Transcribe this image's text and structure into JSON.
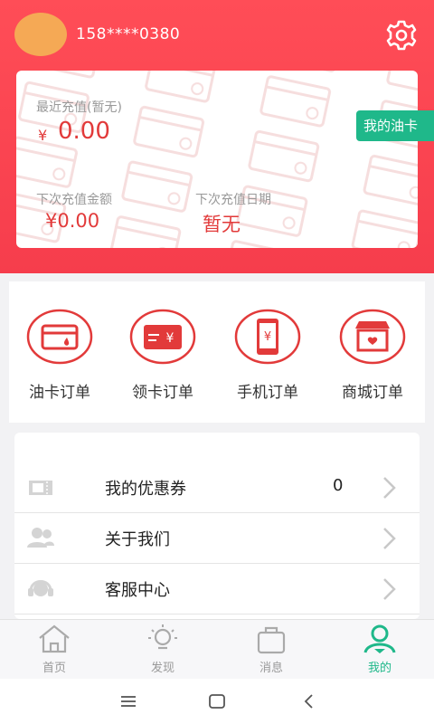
{
  "header": {
    "phone": "158****0380",
    "settings_icon": "gear-icon"
  },
  "card": {
    "recent_label": "最近充值(暂无)",
    "recent_currency": "¥",
    "recent_amount": "0.00",
    "next_amount_label": "下次充值金额",
    "next_amount": "¥0.00",
    "next_date_label": "下次充值日期",
    "next_date": "暂无",
    "oil_card_label": "我的油卡",
    "oil_card_arrow": "〉"
  },
  "orders": [
    {
      "label": "油卡订单",
      "icon": "oil-card-icon"
    },
    {
      "label": "领卡订单",
      "icon": "card-yuan-icon"
    },
    {
      "label": "手机订单",
      "icon": "phone-yuan-icon"
    },
    {
      "label": "商城订单",
      "icon": "shop-icon"
    }
  ],
  "menu": [
    {
      "label": "我的优惠券",
      "count": "0",
      "icon": "coupon-icon"
    },
    {
      "label": "关于我们",
      "icon": "users-icon"
    },
    {
      "label": "客服中心",
      "icon": "headset-icon"
    }
  ],
  "tabs": [
    {
      "label": "首页",
      "icon": "home-icon"
    },
    {
      "label": "发现",
      "icon": "bulb-icon"
    },
    {
      "label": "消息",
      "icon": "bag-icon"
    },
    {
      "label": "我的",
      "icon": "user-icon"
    }
  ],
  "colors": {
    "brand_red": "#f63d4c",
    "value_red": "#e23a3a",
    "accent_green": "#1fb88a",
    "avatar": "#f5a955"
  }
}
